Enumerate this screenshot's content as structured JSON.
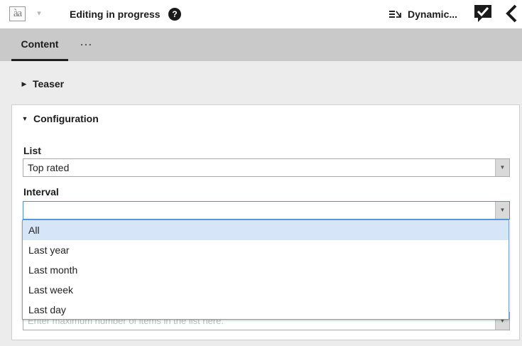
{
  "header": {
    "logo_text": "àa",
    "logo_caret": "▾",
    "status": "Editing in progress",
    "help": "?",
    "dynamic_label": "Dynamic...",
    "icons": [
      "text-logo-icon",
      "help-icon",
      "dynamic-list-icon",
      "checkmark-comment-icon",
      "back-chevron-icon"
    ]
  },
  "tabs": [
    {
      "label": "Content",
      "active": true
    },
    {
      "label": "..."
    }
  ],
  "sections": {
    "teaser": {
      "label": "Teaser",
      "expanded": false
    },
    "configuration": {
      "label": "Configuration",
      "expanded": true
    }
  },
  "fields": {
    "list": {
      "label": "List",
      "value": "Top rated"
    },
    "interval": {
      "label": "Interval",
      "value": "",
      "options": [
        "All",
        "Last year",
        "Last month",
        "Last week",
        "Last day"
      ],
      "highlighted": "All"
    },
    "max_items": {
      "placeholder": "Enter maximum number of items in the list here."
    }
  },
  "colors": {
    "tabbar_bg": "#c9c9c9",
    "panel_bg": "#ececec",
    "option_highlight": "#d6e6f8",
    "focus_border": "#4a90d9"
  }
}
